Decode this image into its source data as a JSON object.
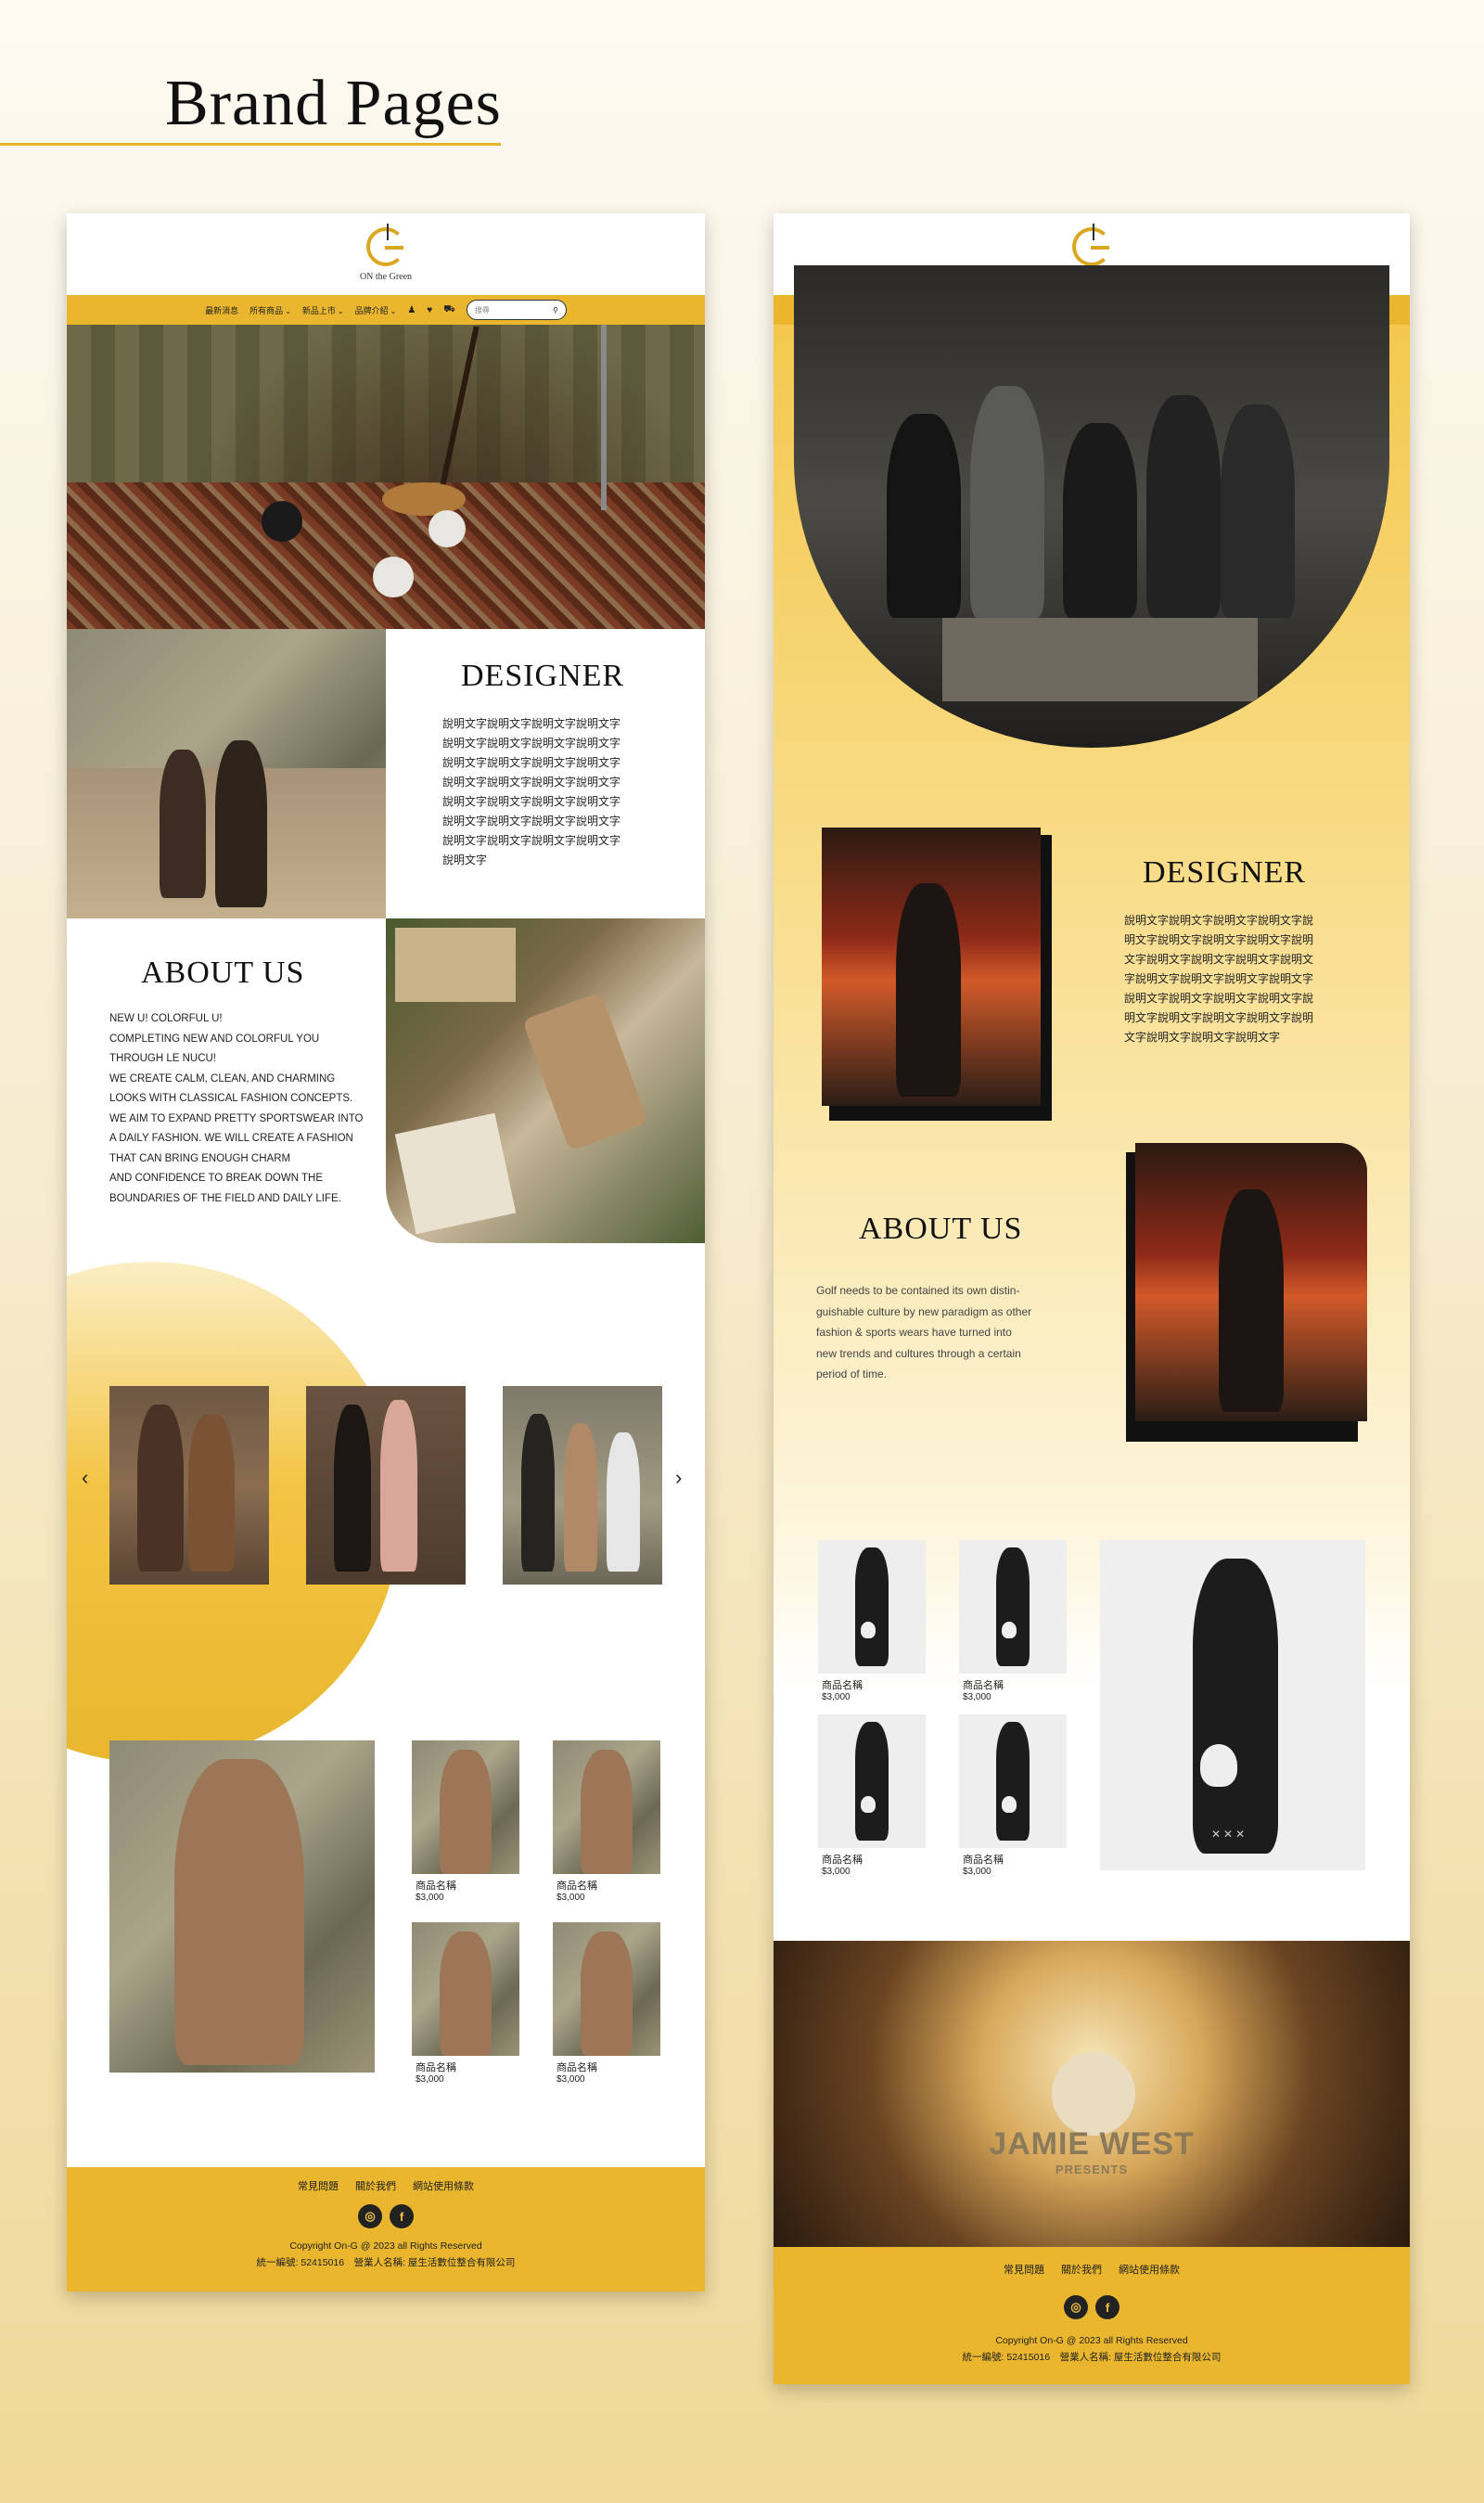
{
  "page": {
    "title": "Brand Pages"
  },
  "colors": {
    "accent": "#e9b62e",
    "background": "#f7ecd0",
    "text": "#222222"
  },
  "header": {
    "logo_text": "ON the Green",
    "nav": [
      "最新消息",
      "所有商品",
      "新品上市",
      "品牌介紹"
    ],
    "nav_dropdown_flags": [
      false,
      true,
      true,
      true
    ],
    "icons": [
      "user-icon",
      "heart-icon",
      "cart-icon"
    ],
    "search_placeholder": "搜尋"
  },
  "left": {
    "designer": {
      "heading": "DESIGNER",
      "lines": [
        "說明文字說明文字說明文字說明文字",
        "說明文字說明文字說明文字說明文字",
        "說明文字說明文字說明文字說明文字",
        "說明文字說明文字說明文字說明文字",
        "說明文字說明文字說明文字說明文字",
        "說明文字說明文字說明文字說明文字",
        "說明文字說明文字說明文字說明文字",
        "說明文字"
      ]
    },
    "about": {
      "heading": "ABOUT US",
      "lines": [
        "NEW U! COLORFUL U!",
        "COMPLETING NEW AND COLORFUL YOU",
        "THROUGH LE NUCU!",
        "WE CREATE CALM, CLEAN, AND CHARMING",
        "LOOKS WITH CLASSICAL FASHION CONCEPTS.",
        "WE AIM TO EXPAND PRETTY SPORTSWEAR INTO",
        "A DAILY FASHION. WE WILL CREATE A FASHION",
        "THAT CAN BRING ENOUGH CHARM",
        "AND CONFIDENCE TO BREAK DOWN THE",
        "BOUNDARIES OF THE FIELD AND DAILY LIFE."
      ]
    },
    "carousel": {
      "prev": "‹",
      "next": "›"
    },
    "products": [
      {
        "name": "商品名稱",
        "price": "$3,000"
      },
      {
        "name": "商品名稱",
        "price": "$3,000"
      },
      {
        "name": "商品名稱",
        "price": "$3,000"
      },
      {
        "name": "商品名稱",
        "price": "$3,000"
      }
    ]
  },
  "right": {
    "designer": {
      "heading": "DESIGNER",
      "lines": [
        "說明文字說明文字說明文字說明文字說",
        "明文字說明文字說明文字說明文字說明",
        "文字說明文字說明文字說明文字說明文",
        "字說明文字說明文字說明文字說明文字",
        "說明文字說明文字說明文字說明文字說",
        "明文字說明文字說明文字說明文字說明",
        "文字說明文字說明文字說明文字"
      ]
    },
    "about": {
      "heading": "ABOUT US",
      "lines": [
        "Golf needs to be contained its own distin-",
        "guishable culture by new paradigm as other",
        "fashion & sports wears have turned into",
        "new trends and cultures through a certain",
        "period of time."
      ]
    },
    "products": [
      {
        "name": "商品名稱",
        "price": "$3,000"
      },
      {
        "name": "商品名稱",
        "price": "$3,000"
      },
      {
        "name": "商品名稱",
        "price": "$3,000"
      },
      {
        "name": "商品名稱",
        "price": "$3,000"
      }
    ],
    "banner": {
      "line1": "JAMIE WEST",
      "line2": "PRESENTS"
    }
  },
  "footer": {
    "links": [
      "常見問題",
      "關於我們",
      "網站使用條款"
    ],
    "copyright": "Copyright On-G @ 2023 all Rights Reserved",
    "company": "統一編號: 52415016　營業人名稱: 屋生活數位整合有限公司"
  }
}
